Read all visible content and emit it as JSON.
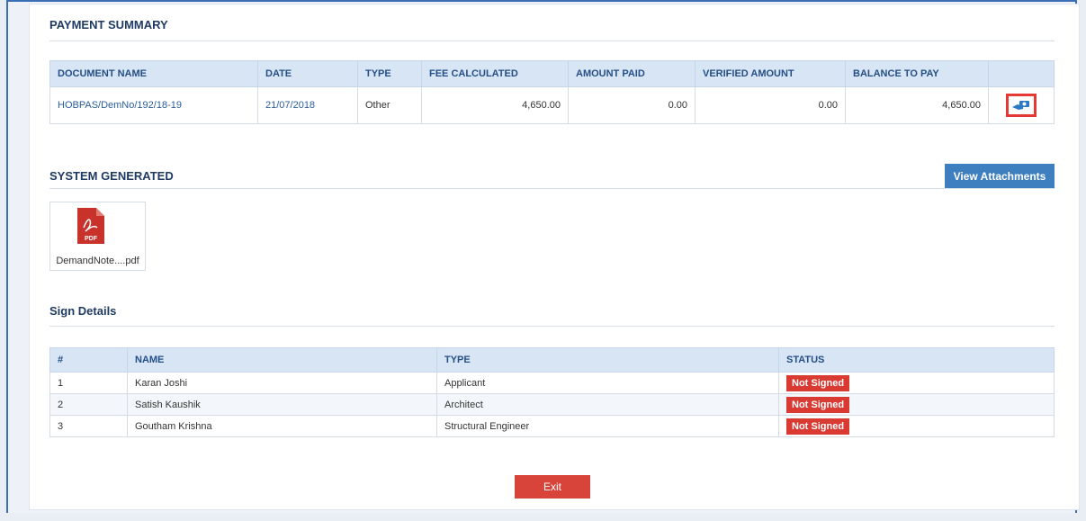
{
  "payment": {
    "title": "PAYMENT SUMMARY",
    "headers": [
      "DOCUMENT NAME",
      "DATE",
      "TYPE",
      "FEE CALCULATED",
      "AMOUNT PAID",
      "VERIFIED AMOUNT",
      "BALANCE TO PAY"
    ],
    "row": {
      "document": "HOBPAS/DemNo/192/18-19",
      "date": "21/07/2018",
      "type": "Other",
      "fee": "4,650.00",
      "paid": "0.00",
      "verified": "0.00",
      "balance": "4,650.00",
      "action_icon": "pay-icon"
    }
  },
  "system": {
    "title": "SYSTEM GENERATED",
    "view_button": "View Attachments",
    "file_name": "DemandNote....pdf",
    "file_badge": "PDF"
  },
  "sign": {
    "title": "Sign Details",
    "headers": [
      "#",
      "NAME",
      "TYPE",
      "STATUS"
    ],
    "rows": [
      {
        "n": "1",
        "name": "Karan Joshi",
        "type": "Applicant",
        "status": "Not Signed"
      },
      {
        "n": "2",
        "name": "Satish Kaushik",
        "type": "Architect",
        "status": "Not Signed"
      },
      {
        "n": "3",
        "name": "Goutham Krishna",
        "type": "Structural Engineer",
        "status": "Not Signed"
      }
    ]
  },
  "exit_button": "Exit",
  "colors": {
    "accent": "#3e7fc0",
    "danger": "#d93a32",
    "header_bg": "#d7e5f5",
    "title": "#1f3b63"
  }
}
